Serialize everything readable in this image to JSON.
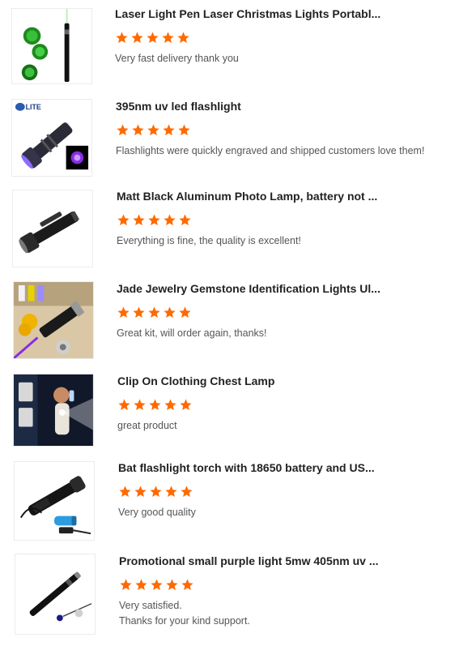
{
  "colors": {
    "star": "#ff6a00",
    "title": "#222222",
    "comment": "#555555"
  },
  "reviews": [
    {
      "title": "Laser Light Pen Laser Christmas Lights Portabl...",
      "rating": 5,
      "comment": "Very fast delivery thank you",
      "thumb_icon": "green-laser-pen-image"
    },
    {
      "title": "395nm uv led flashlight",
      "rating": 5,
      "comment": "Flashlights were quickly engraved and shipped customers love them!",
      "thumb_icon": "uv-flashlight-image",
      "thumb_logo": "LITE"
    },
    {
      "title": "Matt Black Aluminum Photo Lamp, battery not ...",
      "rating": 5,
      "comment": "Everything is fine, the quality is excellent!",
      "thumb_icon": "black-flashlight-image"
    },
    {
      "title": "Jade Jewelry Gemstone Identification Lights Ul...",
      "rating": 5,
      "comment": "Great kit, will order again, thanks!",
      "thumb_icon": "gemstone-light-image"
    },
    {
      "title": "Clip On Clothing Chest Lamp",
      "rating": 5,
      "comment": "great product",
      "thumb_icon": "chest-lamp-image"
    },
    {
      "title": "Bat flashlight torch with 18650 battery and US...",
      "rating": 5,
      "comment": "Very good quality",
      "thumb_icon": "bat-flashlight-image"
    },
    {
      "title": "Promotional small purple light 5mw 405nm uv ...",
      "rating": 5,
      "comment_line1": "Very satisfied.",
      "comment_line2": "Thanks for your kind support.",
      "thumb_icon": "purple-laser-pen-image"
    }
  ]
}
